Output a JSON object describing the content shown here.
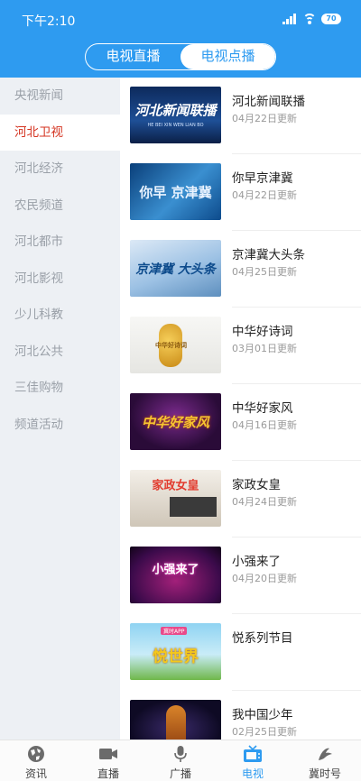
{
  "status_bar": {
    "time": "下午2:10",
    "battery": "70"
  },
  "segment": {
    "tabs": [
      "电视直播",
      "电视点播"
    ],
    "active_index": 1
  },
  "sidebar": {
    "active_index": 1,
    "items": [
      {
        "label": "央视新闻"
      },
      {
        "label": "河北卫视"
      },
      {
        "label": "河北经济"
      },
      {
        "label": "农民频道"
      },
      {
        "label": "河北都市"
      },
      {
        "label": "河北影视"
      },
      {
        "label": "少儿科教"
      },
      {
        "label": "河北公共"
      },
      {
        "label": "三佳购物"
      },
      {
        "label": "频道活动"
      }
    ]
  },
  "programs": [
    {
      "title": "河北新闻联播",
      "date": "04月22日更新",
      "thumb_text": "河北新闻联播",
      "thumb_sub": "HE BEI XIN WEN LIAN BO"
    },
    {
      "title": "你早京津冀",
      "date": "04月22日更新",
      "thumb_text": "你早 京津冀"
    },
    {
      "title": "京津冀大头条",
      "date": "04月25日更新",
      "thumb_text": "京津冀 大头条"
    },
    {
      "title": "中华好诗词",
      "date": "03月01日更新",
      "thumb_text": "中华好诗词"
    },
    {
      "title": "中华好家风",
      "date": "04月16日更新",
      "thumb_text": "中华好家风"
    },
    {
      "title": "家政女皇",
      "date": "04月24日更新",
      "thumb_text": "家政女皇"
    },
    {
      "title": "小强来了",
      "date": "04月20日更新",
      "thumb_text": "小强来了"
    },
    {
      "title": "悦系列节目",
      "date": "",
      "thumb_text": "悦世界",
      "thumb_badge": "冀时APP"
    },
    {
      "title": "我中国少年",
      "date": "02月25日更新",
      "thumb_text": ""
    }
  ],
  "tabbar": {
    "active_index": 3,
    "items": [
      {
        "label": "资讯",
        "icon": "globe-icon"
      },
      {
        "label": "直播",
        "icon": "video-camera-icon"
      },
      {
        "label": "广播",
        "icon": "microphone-icon"
      },
      {
        "label": "电视",
        "icon": "tv-icon"
      },
      {
        "label": "冀时号",
        "icon": "ji-logo-icon"
      }
    ]
  },
  "colors": {
    "primary": "#2e9bf0",
    "sidebar_active": "#d4321f",
    "sidebar_bg": "#edf0f4"
  }
}
